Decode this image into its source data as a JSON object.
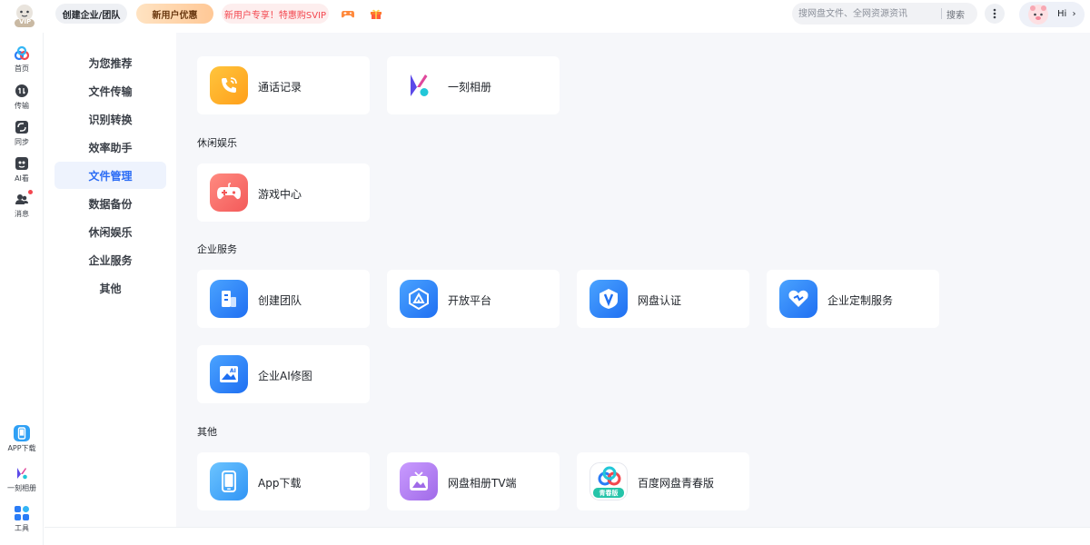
{
  "topbar": {
    "vip_badge": "VIP",
    "create_team": "创建企业/团队",
    "new_user_offer": "新用户优惠",
    "svip_promo": "新用户专享！特惠购SVIP",
    "search_placeholder": "搜网盘文件、全网资源资讯",
    "search_button": "搜索",
    "greeting": "Hi",
    "greeting_arrow": "›"
  },
  "rail": {
    "items": [
      {
        "label": "首页",
        "icon": "home-icon"
      },
      {
        "label": "传输",
        "icon": "transfer-icon"
      },
      {
        "label": "同步",
        "icon": "sync-icon"
      },
      {
        "label": "AI看",
        "icon": "ai-view-icon"
      },
      {
        "label": "消息",
        "icon": "message-icon"
      }
    ],
    "bottom_items": [
      {
        "label": "APP下载",
        "icon": "app-download-icon"
      },
      {
        "label": "一刻相册",
        "icon": "photo-album-icon"
      },
      {
        "label": "工具",
        "icon": "tools-icon"
      }
    ]
  },
  "categories": {
    "items": [
      "为您推荐",
      "文件传输",
      "识别转换",
      "效率助手",
      "文件管理",
      "数据备份",
      "休闲娱乐",
      "企业服务",
      "其他"
    ],
    "active_index": 4
  },
  "main": {
    "top_cards": [
      {
        "label": "通话记录",
        "icon": "phone-call-icon"
      },
      {
        "label": "一刻相册",
        "icon": "yike-album-icon"
      }
    ],
    "sections": [
      {
        "title": "休闲娱乐",
        "cards": [
          {
            "label": "游戏中心",
            "icon": "gamepad-icon"
          }
        ]
      },
      {
        "title": "企业服务",
        "cards": [
          {
            "label": "创建团队",
            "icon": "building-icon"
          },
          {
            "label": "开放平台",
            "icon": "open-platform-icon"
          },
          {
            "label": "网盘认证",
            "icon": "verify-icon"
          },
          {
            "label": "企业定制服务",
            "icon": "heart-shield-icon"
          },
          {
            "label": "企业AI修图",
            "icon": "ai-image-icon"
          }
        ]
      },
      {
        "title": "其他",
        "cards": [
          {
            "label": "App下载",
            "icon": "phone-icon"
          },
          {
            "label": "网盘相册TV端",
            "icon": "tv-icon"
          },
          {
            "label": "百度网盘青春版",
            "icon": "youth-edition-icon"
          }
        ]
      }
    ],
    "youth_badge": "青春版"
  },
  "colors": {
    "accent": "#2b6cf5",
    "active_bg": "#eef3fd",
    "main_bg": "#f6f7fa",
    "svip_red": "#f3474f",
    "orange": "#ffb52e",
    "coral": "#f96a6a",
    "blue": "#2a7cf6",
    "lightblue": "#4aa8f7",
    "purple": "#b27ef0"
  }
}
